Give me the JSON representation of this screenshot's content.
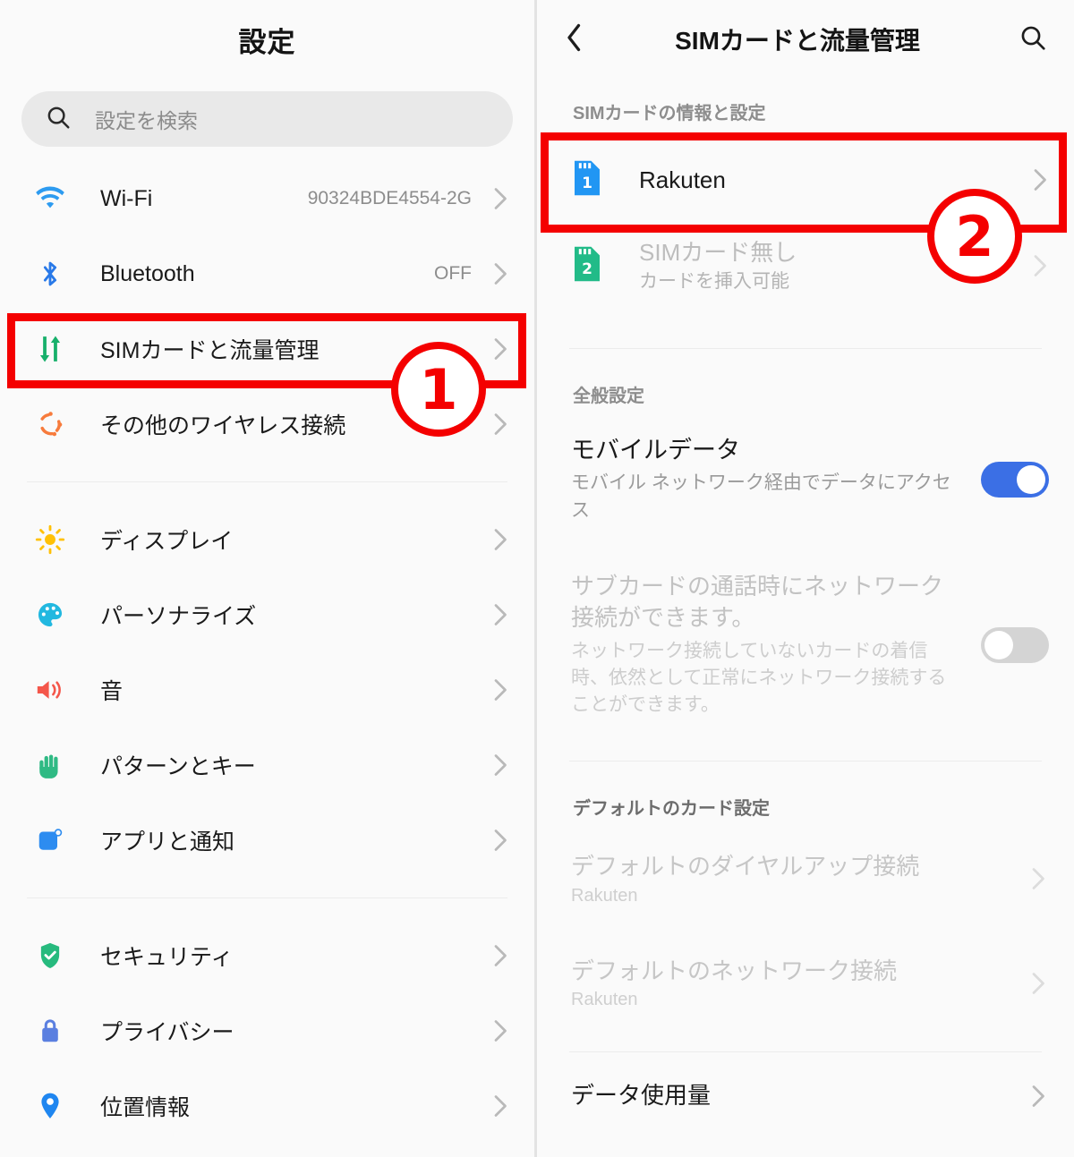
{
  "left_panel": {
    "title": "設定",
    "search": {
      "placeholder": "設定を検索",
      "icon": "search-icon"
    },
    "items": [
      {
        "icon": "wifi-icon",
        "label": "Wi-Fi",
        "value": "90324BDE4554-2G"
      },
      {
        "icon": "bluetooth-icon",
        "label": "Bluetooth",
        "value": "OFF"
      },
      {
        "icon": "sim-data-icon",
        "label": "SIMカードと流量管理",
        "value": ""
      },
      {
        "icon": "wireless-sync-icon",
        "label": "その他のワイヤレス接続",
        "value": ""
      },
      {
        "icon": "brightness-icon",
        "label": "ディスプレイ",
        "value": ""
      },
      {
        "icon": "palette-icon",
        "label": "パーソナライズ",
        "value": ""
      },
      {
        "icon": "speaker-icon",
        "label": "音",
        "value": ""
      },
      {
        "icon": "hand-icon",
        "label": "パターンとキー",
        "value": ""
      },
      {
        "icon": "apps-icon",
        "label": "アプリと通知",
        "value": ""
      },
      {
        "icon": "shield-check-icon",
        "label": "セキュリティ",
        "value": ""
      },
      {
        "icon": "lock-icon",
        "label": "プライバシー",
        "value": ""
      },
      {
        "icon": "location-pin-icon",
        "label": "位置情報",
        "value": ""
      }
    ]
  },
  "right_panel": {
    "back_icon": "back-chevron-icon",
    "title": "SIMカードと流量管理",
    "search_icon": "search-icon",
    "sim_section": {
      "header": "SIMカードの情報と設定",
      "cards": [
        {
          "slot": "1",
          "color": "#2196f3",
          "title": "Rakuten",
          "subtitle": "",
          "disabled": false
        },
        {
          "slot": "2",
          "color": "#22bb88",
          "title": "SIMカード無し",
          "subtitle": "カードを挿入可能",
          "disabled": true
        }
      ]
    },
    "general_section": {
      "header": "全般設定",
      "rows": [
        {
          "title": "モバイルデータ",
          "subtitle": "モバイル ネットワーク経由でデータにアクセス",
          "toggle": "on",
          "disabled": false
        },
        {
          "title": "サブカードの通話時にネットワーク接続ができます。",
          "subtitle": "ネットワーク接続していないカードの着信時、依然として正常にネットワーク接続することができます。",
          "toggle": "off",
          "disabled": true
        }
      ]
    },
    "default_card_section": {
      "header": "デフォルトのカード設定",
      "rows": [
        {
          "title": "デフォルトのダイヤルアップ接続",
          "subtitle": "Rakuten"
        },
        {
          "title": "デフォルトのネットワーク接続",
          "subtitle": "Rakuten"
        }
      ]
    },
    "data_usage_section": {
      "title": "データ使用量"
    }
  },
  "annotations": {
    "colors": {
      "highlight": "#f40000"
    },
    "markers": [
      {
        "number": "①",
        "digit": "1",
        "target": "SIMカードと流量管理"
      },
      {
        "number": "②",
        "digit": "2",
        "target": "Rakuten"
      }
    ]
  }
}
